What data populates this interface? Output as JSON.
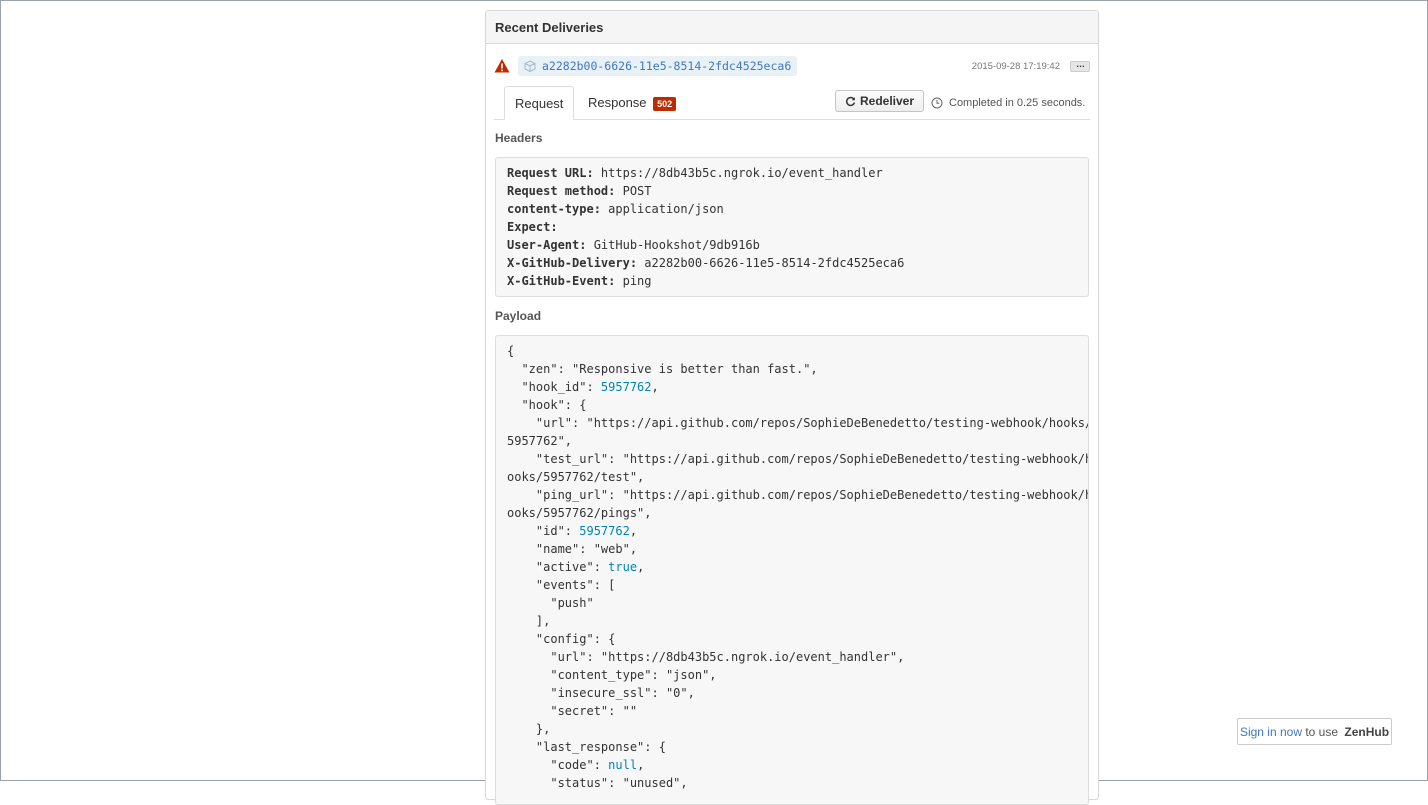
{
  "panel": {
    "title": "Recent Deliveries"
  },
  "delivery": {
    "guid": "a2282b00-6626-11e5-8514-2fdc4525eca6",
    "timestamp": "2015-09-28 17:19:42",
    "more_label": "…",
    "status_icon": "warning-icon"
  },
  "tabs": {
    "request_label": "Request",
    "response_label": "Response",
    "response_badge": "502"
  },
  "actions": {
    "redeliver_label": "Redeliver",
    "completed_text": "Completed in 0.25 seconds."
  },
  "headers": {
    "title": "Headers",
    "rows": [
      {
        "key": "Request URL:",
        "value": "https://8db43b5c.ngrok.io/event_handler"
      },
      {
        "key": "Request method:",
        "value": "POST"
      },
      {
        "key": "content-type:",
        "value": "application/json"
      },
      {
        "key": "Expect:",
        "value": ""
      },
      {
        "key": "User-Agent:",
        "value": "GitHub-Hookshot/9db916b"
      },
      {
        "key": "X-GitHub-Delivery:",
        "value": "a2282b00-6626-11e5-8514-2fdc4525eca6"
      },
      {
        "key": "X-GitHub-Event:",
        "value": "ping"
      }
    ]
  },
  "payload": {
    "title": "Payload",
    "lines": [
      [
        {
          "t": "{"
        }
      ],
      [
        {
          "t": "  \"zen\": \"Responsive is better than fast.\","
        }
      ],
      [
        {
          "t": "  \"hook_id\": "
        },
        {
          "t": "5957762",
          "c": "n"
        },
        {
          "t": ","
        }
      ],
      [
        {
          "t": "  \"hook\": {"
        }
      ],
      [
        {
          "t": "    \"url\": \"https://api.github.com/repos/SophieDeBenedetto/testing-webhook/hooks/"
        }
      ],
      [
        {
          "t": "5957762\","
        }
      ],
      [
        {
          "t": "    \"test_url\": \"https://api.github.com/repos/SophieDeBenedetto/testing-webhook/h"
        }
      ],
      [
        {
          "t": "ooks/5957762/test\","
        }
      ],
      [
        {
          "t": "    \"ping_url\": \"https://api.github.com/repos/SophieDeBenedetto/testing-webhook/h"
        }
      ],
      [
        {
          "t": "ooks/5957762/pings\","
        }
      ],
      [
        {
          "t": "    \"id\": "
        },
        {
          "t": "5957762",
          "c": "n"
        },
        {
          "t": ","
        }
      ],
      [
        {
          "t": "    \"name\": \"web\","
        }
      ],
      [
        {
          "t": "    \"active\": "
        },
        {
          "t": "true",
          "c": "n"
        },
        {
          "t": ","
        }
      ],
      [
        {
          "t": "    \"events\": ["
        }
      ],
      [
        {
          "t": "      \"push\""
        }
      ],
      [
        {
          "t": "    ],"
        }
      ],
      [
        {
          "t": "    \"config\": {"
        }
      ],
      [
        {
          "t": "      \"url\": \"https://8db43b5c.ngrok.io/event_handler\","
        }
      ],
      [
        {
          "t": "      \"content_type\": \"json\","
        }
      ],
      [
        {
          "t": "      \"insecure_ssl\": \"0\","
        }
      ],
      [
        {
          "t": "      \"secret\": \"\""
        }
      ],
      [
        {
          "t": "    },"
        }
      ],
      [
        {
          "t": "    \"last_response\": {"
        }
      ],
      [
        {
          "t": "      \"code\": "
        },
        {
          "t": "null",
          "c": "n"
        },
        {
          "t": ","
        }
      ],
      [
        {
          "t": "      \"status\": \"unused\","
        }
      ]
    ]
  },
  "zenhub": {
    "link_text": "Sign in now",
    "middle_text": " to use ",
    "brand": "ZenHub"
  },
  "colors": {
    "link": "#4078c0",
    "badge": "#bd2c00",
    "warning": "#bd2c00",
    "number": "#0086b3"
  }
}
